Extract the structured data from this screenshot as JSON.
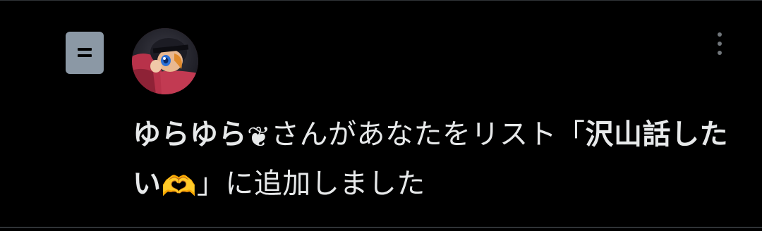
{
  "notification": {
    "user_name": "ゆらゆら",
    "user_emoji": "❦",
    "text_before_list": "さんがあなたをリスト「",
    "list_name": "沢山話したい",
    "list_emoji": "🫶",
    "text_after_list": "」に追加しました"
  },
  "icons": {
    "list": "list-icon",
    "avatar": "user-avatar",
    "more": "more-options-icon"
  },
  "colors": {
    "background": "#000000",
    "text": "#e7e9ea",
    "list_icon_bg": "#8b98a5",
    "muted": "#71767b",
    "divider": "#2f3336"
  }
}
